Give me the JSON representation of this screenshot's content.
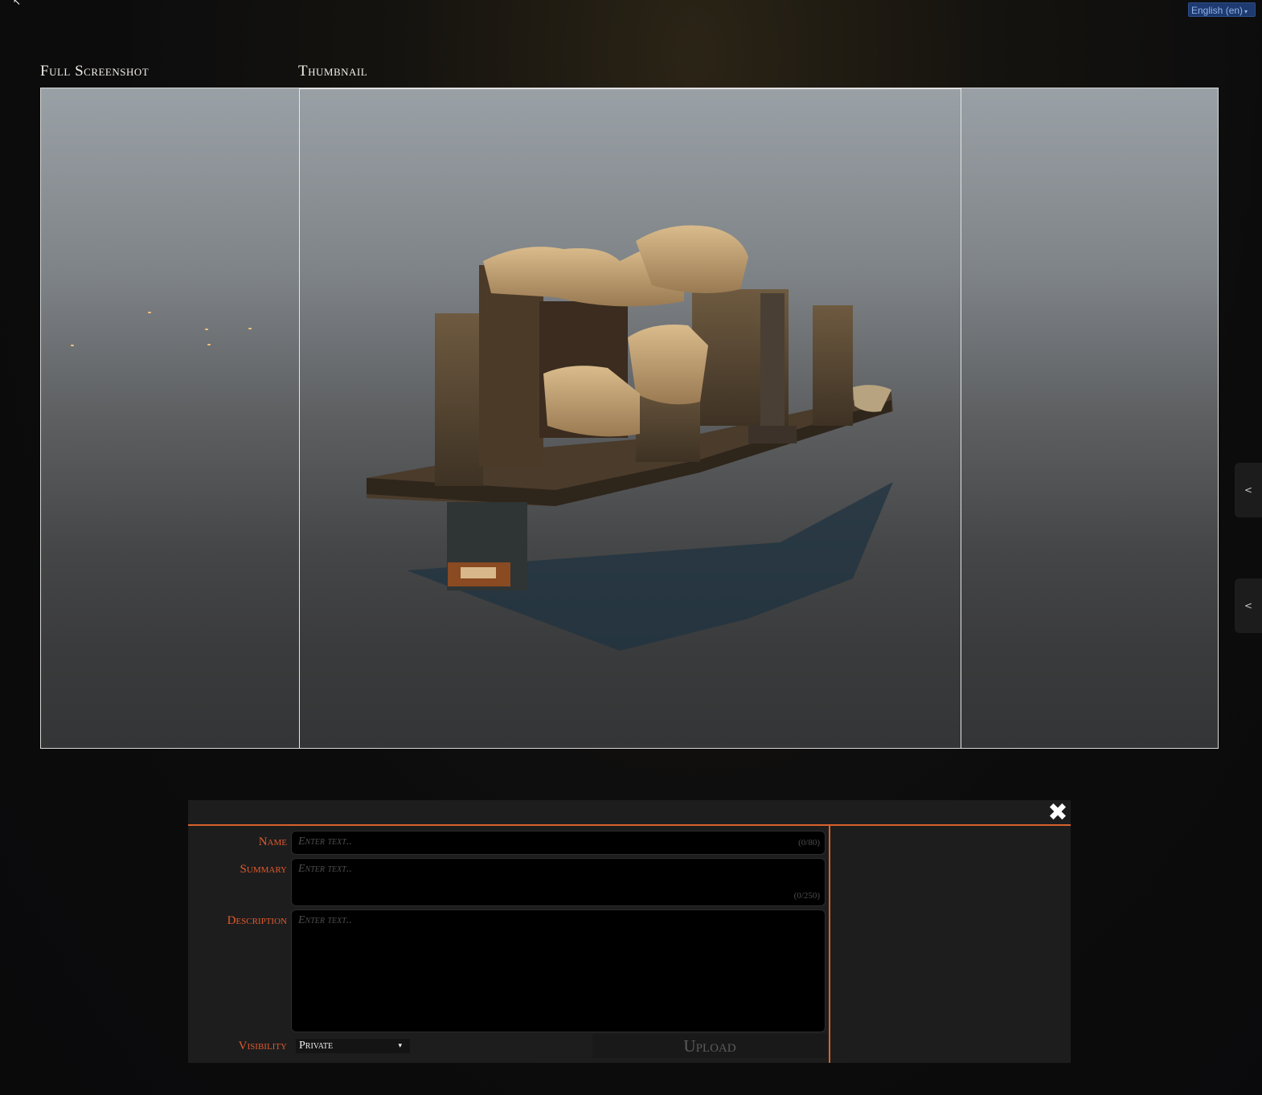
{
  "lang": {
    "label": "English (en)",
    "caret": "▾"
  },
  "labels": {
    "full_screenshot": "Full Screenshot",
    "thumbnail": "Thumbnail"
  },
  "side_tabs": [
    "<",
    "<"
  ],
  "form": {
    "close": "✖",
    "name": {
      "label": "Name",
      "placeholder": "Enter text..",
      "counter": "(0/80)"
    },
    "summary": {
      "label": "Summary",
      "placeholder": "Enter text..",
      "counter": "(0/250)"
    },
    "description": {
      "label": "Description",
      "placeholder": "Enter text.."
    },
    "visibility": {
      "label": "Visibility",
      "value": "Private",
      "caret": "▾"
    },
    "upload": "Upload"
  },
  "colors": {
    "accent": "#d9622b",
    "label": "#e15a2a",
    "lang_bg": "#1e3a6e"
  },
  "icons": {
    "cursor": "cursor-icon",
    "close": "close-icon",
    "chevron": "chevron-left-icon",
    "caret": "caret-down-icon"
  }
}
